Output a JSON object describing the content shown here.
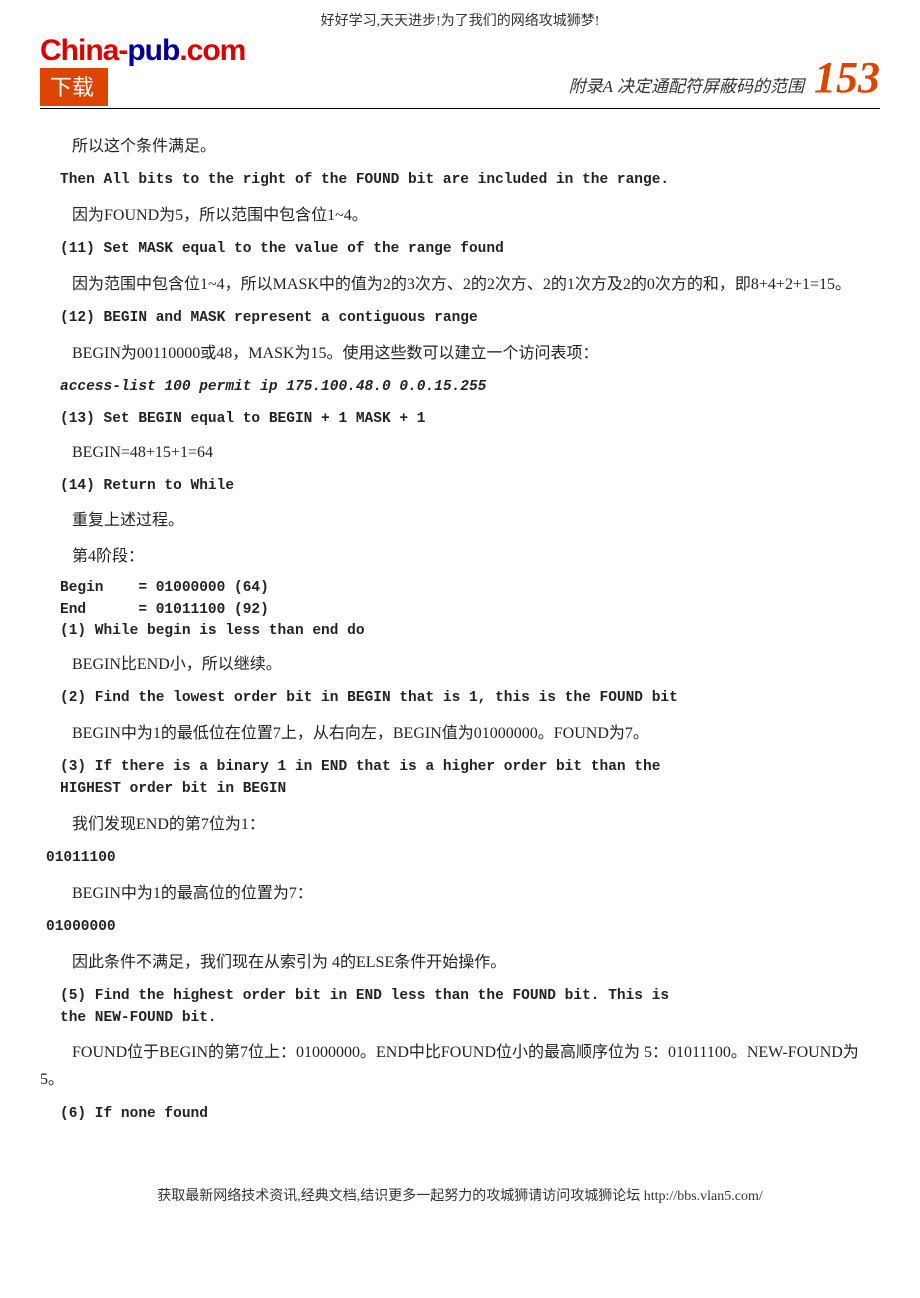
{
  "top_slogan": "好好学习,天天进步!为了我们的网络攻城狮梦!",
  "logo": {
    "part1": "China-",
    "part2": "pub",
    "part3": ".com",
    "download": "下载"
  },
  "header": {
    "appendix": "附录A  决定通配符屏蔽码的范围",
    "page_number": "153"
  },
  "content": {
    "p1": "所以这个条件满足。",
    "c1": "Then All bits to the right of the FOUND bit are included in the range.",
    "p2": "因为FOUND为5，所以范围中包含位1~4。",
    "c2": "(11) Set MASK equal to the value of the range found",
    "p3": "因为范围中包含位1~4，所以MASK中的值为2的3次方、2的2次方、2的1次方及2的0次方的和，即8+4+2+1=15。",
    "c3": "(12) BEGIN and MASK represent a contiguous range",
    "p4": "BEGIN为00110000或48，MASK为15。使用这些数可以建立一个访问表项：",
    "c4": "access-list 100 permit ip 175.100.48.0 0.0.15.255",
    "c5": "(13) Set BEGIN equal to BEGIN + 1 MASK + 1",
    "p5": "BEGIN=48+15+1=64",
    "c6": "(14) Return to While",
    "p6": "重复上述过程。",
    "p7": "第4阶段：",
    "c7": "Begin    = 01000000 (64)\nEnd      = 01011100 (92)\n(1) While begin is less than end do",
    "p8": "BEGIN比END小，所以继续。",
    "c8": "(2) Find the lowest order bit in BEGIN that is 1, this is the FOUND bit",
    "p9": "BEGIN中为1的最低位在位置7上，从右向左，BEGIN值为01000000。FOUND为7。",
    "c9": "(3) If there is a binary 1 in END that is a higher order bit than the\nHIGHEST order bit in BEGIN",
    "p10": "我们发现END的第7位为1：",
    "c10": "01011100",
    "p11": "BEGIN中为1的最高位的位置为7：",
    "c11": "01000000",
    "p12": "因此条件不满足，我们现在从索引为 4的ELSE条件开始操作。",
    "c12": "(5) Find the highest order bit in END less than the FOUND bit. This is\nthe NEW-FOUND bit.",
    "p13": "FOUND位于BEGIN的第7位上：01000000。END中比FOUND位小的最高顺序位为 5：01011100。NEW-FOUND为5。",
    "c13": "(6) If none found"
  },
  "footer": "获取最新网络技术资讯,经典文档,结识更多一起努力的攻城狮请访问攻城狮论坛 http://bbs.vlan5.com/"
}
